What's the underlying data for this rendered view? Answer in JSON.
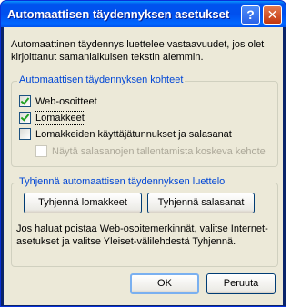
{
  "window": {
    "title": "Automaattisen täydennyksen asetukset",
    "help_symbol": "?",
    "close_symbol": "✕"
  },
  "intro_text": "Automaattinen täydennys luettelee vastaavuudet, jos olet kirjoittanut samanlaikuisen tekstin aiemmin.",
  "targets_group": {
    "title": "Automaattisen täydennyksen kohteet",
    "options": [
      {
        "label": "Web-osoitteet",
        "checked": true,
        "enabled": true
      },
      {
        "label": "Lomakkeet",
        "checked": true,
        "enabled": true
      },
      {
        "label": "Lomakkeiden käyttäjätunnukset ja salasanat",
        "checked": false,
        "enabled": true
      },
      {
        "label": "Näytä salasanojen tallentamista koskeva kehote",
        "checked": false,
        "enabled": false
      }
    ]
  },
  "clear_group": {
    "title": "Tyhjennä automaattisen täydennyksen luettelo",
    "clear_forms_label": "Tyhjennä lomakkeet",
    "clear_passwords_label": "Tyhjennä salasanat",
    "note": "Jos haluat poistaa Web-osoitemerkinnät, valitse Internet-asetukset ja valitse Yleiset-välilehdestä Tyhjennä."
  },
  "buttons": {
    "ok_label": "OK",
    "cancel_label": "Peruuta"
  },
  "colors": {
    "titlebar": "#0053ee",
    "dialog_bg": "#ece9d8",
    "group_title": "#0046d5",
    "close_button": "#c2360e",
    "checkmark": "#21a121"
  }
}
